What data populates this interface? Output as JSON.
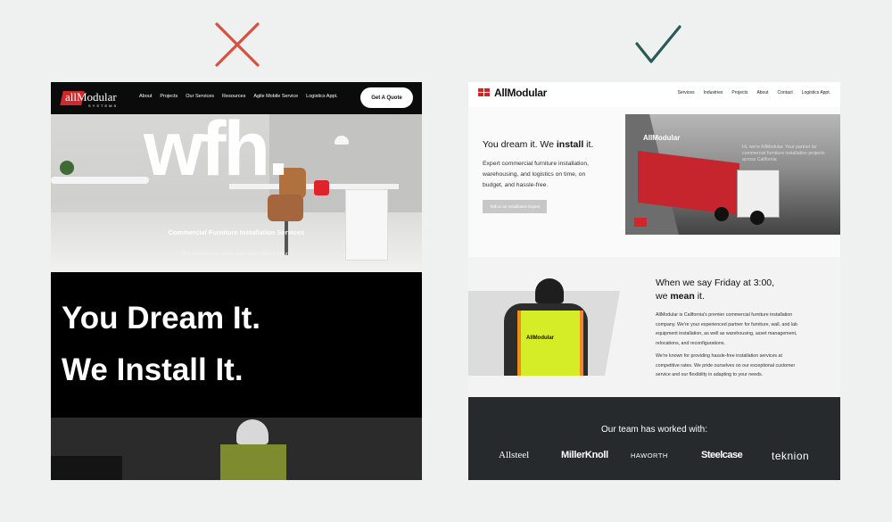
{
  "marks": {
    "cross": "cross-mark-icon",
    "check": "check-mark-icon",
    "cross_color": "#d9503f",
    "check_color": "#2a5a57"
  },
  "left": {
    "logo": {
      "brand": "allModular",
      "sub": "SYSTEMS"
    },
    "nav": [
      "About",
      "Projects",
      "Our Services",
      "Resources",
      "Agile Mobile Service",
      "Logistics Appt."
    ],
    "cta": "Get A Quote",
    "hero": {
      "big": "wfh.",
      "title": "Commercial Furniture Installation Services",
      "subtitle": "The program that builds your home office furniture"
    },
    "headline1": "You Dream It.",
    "headline2": "We Install It."
  },
  "right": {
    "logo": "AllModular",
    "nav": [
      "Services",
      "Industries",
      "Projects",
      "About",
      "Contact",
      "Logistics Appt."
    ],
    "hero": {
      "head_pre": "You dream it. We ",
      "head_bold": "install",
      "head_post": " it.",
      "paragraph": "Expert commercial furniture installation, warehousing, and logistics on time, on budget, and hassle-free.",
      "button": "Talk to an Installation Expert",
      "truck_label": "AllModular",
      "caption": "Hi, we're AllModular. Your partner for commercial furniture installation projects across California"
    },
    "section2": {
      "head_line1": "When we say Friday at 3:00,",
      "head_pre": "we ",
      "head_bold": "mean",
      "head_post": " it.",
      "vest_label": "AllModular",
      "p1": "AllModular is California's premier commercial furniture installation company. We're your experienced partner for furniture, wall, and lab equipment installation, as well as warehousing, asset management, relocations, and reconfigurations.",
      "p2": "We're known for providing hassle-free installation services at competitive rates. We pride ourselves on our exceptional customer service and our flexibility in adapting to your needs."
    },
    "footer": {
      "title": "Our team has worked with:",
      "brands": [
        "Allsteel",
        "MillerKnoll",
        "HAWORTH",
        "Steelcase",
        "teknion"
      ]
    }
  }
}
